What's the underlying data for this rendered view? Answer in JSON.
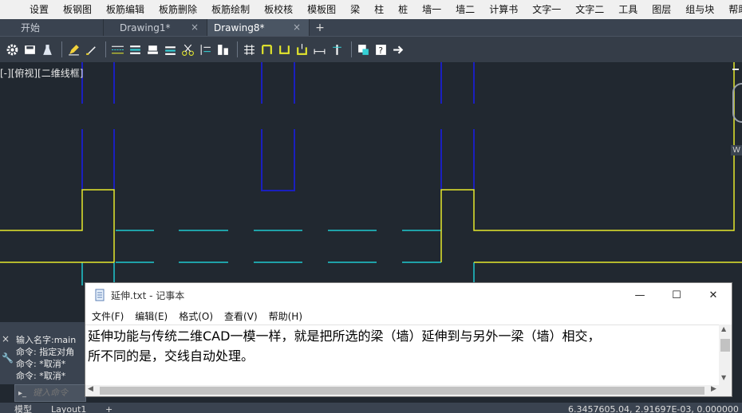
{
  "menubar": {
    "items": [
      "设置",
      "板钢图",
      "板筋编辑",
      "板筋删除",
      "板筋绘制",
      "板校核",
      "模板图",
      "梁",
      "柱",
      "桩",
      "墙一",
      "墙二",
      "计算书",
      "文字一",
      "文字二",
      "工具",
      "图层",
      "组与块",
      "帮助"
    ]
  },
  "tabs": {
    "start": "开始",
    "drawing1": "Drawing1*",
    "drawing8": "Drawing8*",
    "close_glyph": "×",
    "add_glyph": "+"
  },
  "toolbar": {
    "icons": [
      "gear-icon",
      "save-icon",
      "flask-icon",
      "pencil-icon",
      "brush-icon",
      "lines-icon",
      "grid-dots-icon",
      "stamp-icon",
      "list-icon",
      "scissors-icon",
      "align-icon",
      "text-edit-icon",
      "grid-icon",
      "bracket-icon",
      "beam-u-icon",
      "beam-down-icon",
      "dimension-icon",
      "pin-icon",
      "export-icon",
      "help-icon",
      "arrow-right-icon"
    ]
  },
  "canvas": {
    "view_label": "[-][俯视][二维线框]",
    "viewcube_label": "W",
    "colors": {
      "blue": "#1a1fbf",
      "cyan": "#1fc9cf",
      "yellow": "#e5e82c",
      "background": "#212830"
    }
  },
  "command": {
    "lines": [
      "输入名字:main",
      "命令: 指定对角",
      "命令: *取消*",
      "命令: *取消*"
    ],
    "placeholder": "键入命令",
    "close_glyph": "×",
    "wrench_glyph": "🔧"
  },
  "status": {
    "model": "模型",
    "layout1": "Layout1",
    "add": "+",
    "coords": "6.3457605.04, 2.91697E-03, 0.000000"
  },
  "notepad": {
    "title": "延伸.txt - 记事本",
    "menu": [
      "文件(F)",
      "编辑(E)",
      "格式(O)",
      "查看(V)",
      "帮助(H)"
    ],
    "text": "延伸功能与传统二维CAD一模一样，就是把所选的梁（墙）延伸到与另外一梁（墙）相交，\n所不同的是，交线自动处理。",
    "min_glyph": "—",
    "max_glyph": "☐",
    "close_glyph": "✕"
  }
}
